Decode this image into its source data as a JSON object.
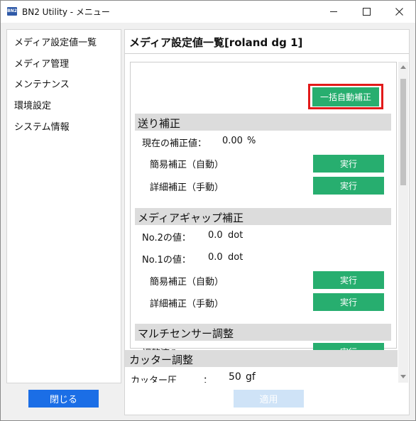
{
  "window": {
    "title": "BN2 Utility - メニュー",
    "icon_text": "BN2"
  },
  "sidebar": {
    "items": [
      {
        "label": "メディア設定値一覧"
      },
      {
        "label": "メディア管理"
      },
      {
        "label": "メンテナンス"
      },
      {
        "label": "環境設定"
      },
      {
        "label": "システム情報"
      }
    ],
    "close_label": "閉じる"
  },
  "main": {
    "title": "メディア設定値一覧[roland dg 1]",
    "bulk_button": "一括自動補正",
    "feed": {
      "header": "送り補正",
      "current_label": "現在の補正値：",
      "current_value": "0.00",
      "current_unit": "%",
      "simple_label": "簡易補正（自動）",
      "detail_label": "詳細補正（手動）"
    },
    "gap": {
      "header": "メディアギャップ補正",
      "no2_label": "No.2の値：",
      "no2_value": "0.0",
      "no2_unit": "dot",
      "no1_label": "No.1の値：",
      "no1_value": "0.0",
      "no1_unit": "dot",
      "simple_label": "簡易補正（自動）",
      "detail_label": "詳細補正（手動）"
    },
    "sensor": {
      "header": "マルチセンサー調整",
      "status_label": "調整済み"
    },
    "run_label": "実行",
    "cutter": {
      "header": "カッター調整",
      "pressure_label": "カッター圧",
      "pressure_sep": "：",
      "pressure_value": "50",
      "pressure_unit": "gf"
    },
    "apply_label": "適用"
  },
  "colors": {
    "accent_green": "#27ae6f",
    "primary_blue": "#1b6ee6",
    "highlight_red": "#e21a1a",
    "disabled_blue": "#cfe3f7"
  }
}
